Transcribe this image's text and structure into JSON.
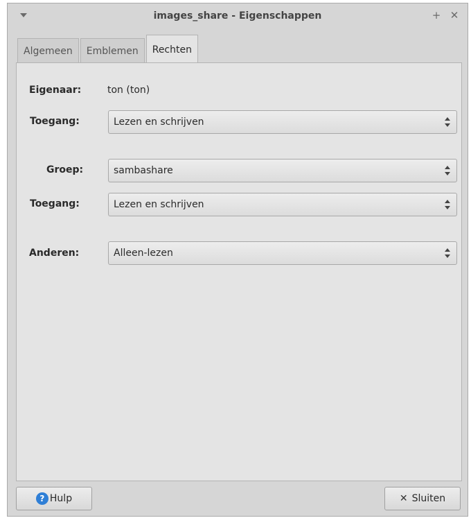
{
  "window": {
    "title": "images_share - Eigenschappen",
    "pin_glyph": "+",
    "close_glyph": "✕"
  },
  "tabs": [
    {
      "label": "Algemeen",
      "active": false
    },
    {
      "label": "Emblemen",
      "active": false
    },
    {
      "label": "Rechten",
      "active": true
    }
  ],
  "permissions": {
    "owner_label": "Eigenaar:",
    "owner_value": "ton (ton)",
    "owner_access_label": "Toegang:",
    "owner_access_value": "Lezen en schrijven",
    "group_label": "Groep:",
    "group_value": "sambashare",
    "group_access_label": "Toegang:",
    "group_access_value": "Lezen en schrijven",
    "others_label": "Anderen:",
    "others_value": "Alleen-lezen"
  },
  "buttons": {
    "help_label": "Hulp",
    "help_icon_glyph": "?",
    "close_label": "Sluiten",
    "close_icon_glyph": "✕"
  },
  "colors": {
    "window_bg": "#d6d6d6",
    "panel_bg": "#e4e4e4",
    "help_icon": "#2f7fd6"
  }
}
